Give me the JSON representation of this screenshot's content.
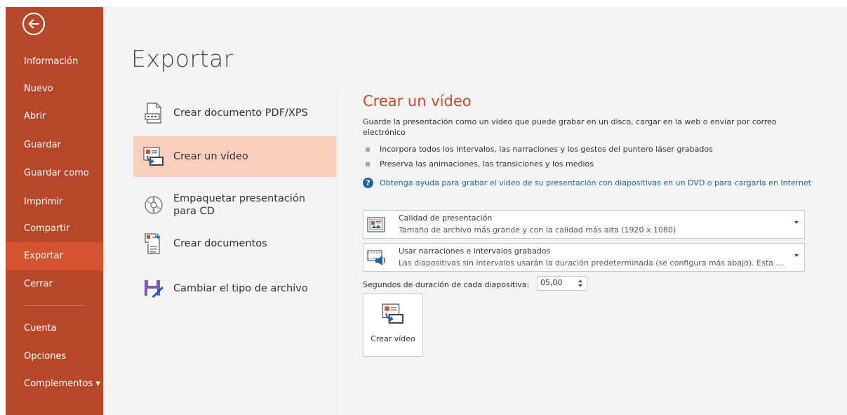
{
  "app": {
    "accent": "#b7472a",
    "accent_active": "#d35230",
    "link_color": "#1e63a7",
    "title_color": "#d24726"
  },
  "sidebar": {
    "back_icon": "back-arrow-icon",
    "items": [
      {
        "label": "Información"
      },
      {
        "label": "Nuevo"
      },
      {
        "label": "Abrir"
      },
      {
        "label": "Guardar"
      },
      {
        "label": "Guardar como"
      },
      {
        "label": "Imprimir"
      },
      {
        "label": "Compartir"
      },
      {
        "label": "Exportar",
        "active": true
      },
      {
        "label": "Cerrar"
      },
      {
        "label": "Cuenta"
      },
      {
        "label": "Opciones"
      },
      {
        "label": "Complementos ▾"
      }
    ]
  },
  "main": {
    "title": "Exportar",
    "options": [
      {
        "label": "Crear documento PDF/XPS",
        "icon": "pdf-document-icon"
      },
      {
        "label": "Crear un vídeo",
        "icon": "video-icon",
        "selected": true
      },
      {
        "label": "Empaquetar presentación para CD",
        "icon": "cd-icon"
      },
      {
        "label": "Crear documentos",
        "icon": "handouts-icon"
      },
      {
        "label": "Cambiar el tipo de archivo",
        "icon": "save-as-type-icon"
      }
    ]
  },
  "detail": {
    "title": "Crear un vídeo",
    "description": "Guarde la presentación como un vídeo que puede grabar en un disco, cargar en la web o enviar por correo electrónico",
    "bullets": [
      "Incorpora todos los intervalos, las narraciones y los gestos del puntero láser grabados",
      "Preserva las animaciones, las transiciones y los medios"
    ],
    "help_link": "Obtenga ayuda para grabar el vídeo de su presentación con diapositivas en un DVD o para cargarla en Internet",
    "quality_dropdown": {
      "title": "Calidad de presentación",
      "subtitle": "Tamaño de archivo más grande y con la calidad más alta (1920 x 1080)"
    },
    "timing_dropdown": {
      "title": "Usar narraciones e intervalos grabados",
      "subtitle": "Las diapositivas sin intervalos usarán la duración predeterminada (se configura más abajo). Esta opci..."
    },
    "seconds_label": "Segundos de duración de cada diapositiva:",
    "seconds_value": "05,00",
    "create_button": "Crear vídeo"
  }
}
